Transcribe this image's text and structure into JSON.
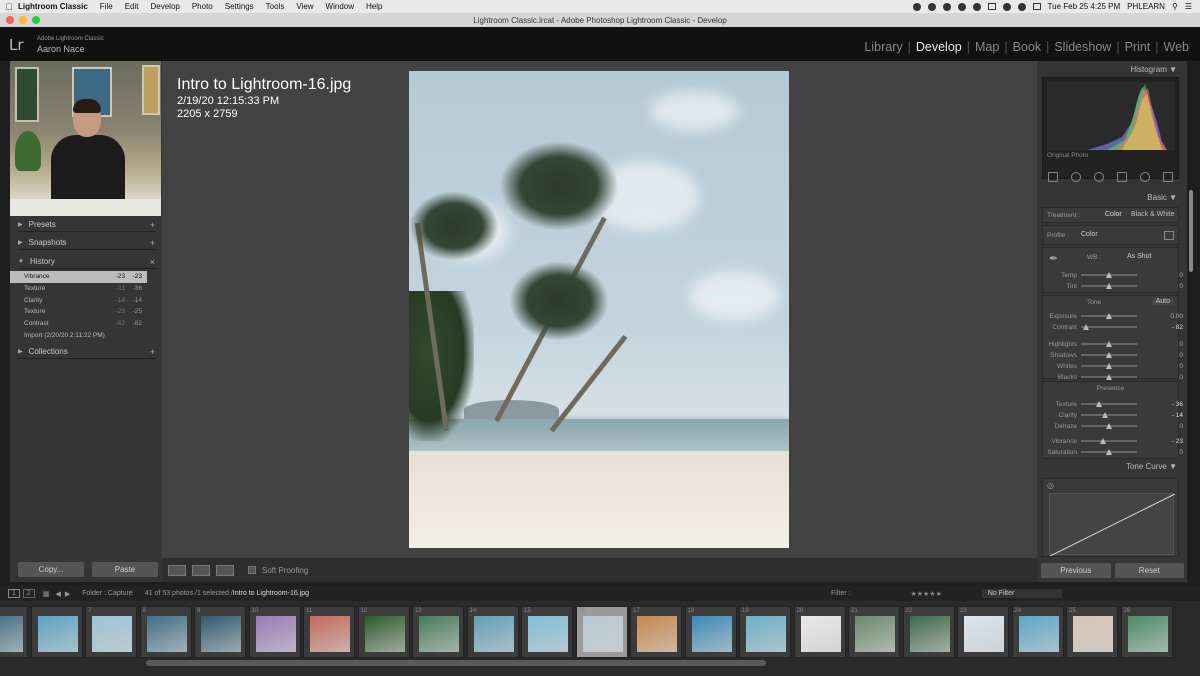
{
  "menubar": {
    "app": "Lightroom Classic",
    "items": [
      "File",
      "Edit",
      "Develop",
      "Photo",
      "Settings",
      "Tools",
      "View",
      "Window",
      "Help"
    ],
    "clock": "Tue Feb 25  4:25 PM",
    "user": "PHLEARN"
  },
  "window": {
    "title": "Lightroom Classic.lrcat - Adobe Photoshop Lightroom Classic - Develop"
  },
  "identity": {
    "logo": "Lr",
    "app": "Adobe Lightroom Classic",
    "user": "Aaron Nace"
  },
  "modules": [
    "Library",
    "Develop",
    "Map",
    "Book",
    "Slideshow",
    "Print",
    "Web"
  ],
  "left": {
    "presets": "Presets",
    "snapshots": "Snapshots",
    "history": "History",
    "collections": "Collections",
    "history_items": [
      {
        "name": "Vibrance",
        "v1": "-23",
        "v2": "-23"
      },
      {
        "name": "Texture",
        "v1": "-11",
        "v2": "-36"
      },
      {
        "name": "Clarity",
        "v1": "-14",
        "v2": "-14"
      },
      {
        "name": "Texture",
        "v1": "-25",
        "v2": "-25"
      },
      {
        "name": "Contrast",
        "v1": "-82",
        "v2": "-82"
      },
      {
        "name": "Import (2/20/20 2:11:22 PM)",
        "v1": "",
        "v2": ""
      }
    ],
    "copy": "Copy...",
    "paste": "Paste"
  },
  "photo": {
    "filename": "Intro to Lightroom-16.jpg",
    "date": "2/19/20 12:15:33 PM",
    "dims": "2205 x 2759"
  },
  "toolbar": {
    "soft_proofing": "Soft Proofing"
  },
  "right": {
    "histogram": "Histogram",
    "original_photo": "Original Photo",
    "basic": "Basic",
    "treatment": "Treatment :",
    "color": "Color",
    "bw": "Black & White",
    "profile": "Profile :",
    "profile_value": "Color",
    "wb": "WB :",
    "wb_value": "As Shot",
    "tone": "Tone",
    "auto": "Auto",
    "presence": "Presence",
    "sliders": [
      {
        "label": "Temp",
        "value": "0",
        "pos": 0.5
      },
      {
        "label": "Tint",
        "value": "0",
        "pos": 0.5
      },
      {
        "label": "Exposure",
        "value": "0.00",
        "pos": 0.5
      },
      {
        "label": "Contrast",
        "value": "- 82",
        "pos": 0.09
      },
      {
        "label": "Highlights",
        "value": "0",
        "pos": 0.5
      },
      {
        "label": "Shadows",
        "value": "0",
        "pos": 0.5
      },
      {
        "label": "Whites",
        "value": "0",
        "pos": 0.5
      },
      {
        "label": "Blacks",
        "value": "0",
        "pos": 0.5
      },
      {
        "label": "Texture",
        "value": "- 36",
        "pos": 0.32
      },
      {
        "label": "Clarity",
        "value": "- 14",
        "pos": 0.43
      },
      {
        "label": "Dehaze",
        "value": "0",
        "pos": 0.5
      },
      {
        "label": "Vibrance",
        "value": "- 23",
        "pos": 0.385
      },
      {
        "label": "Saturation",
        "value": "0",
        "pos": 0.5
      }
    ],
    "tone_curve": "Tone Curve",
    "previous": "Previous",
    "reset": "Reset"
  },
  "filmstrip": {
    "folder": "Folder : Capture",
    "count": "41 of 53 photos /1 selected /",
    "current": "Intro to Lightroom-16.jpg",
    "filter_label": "Filter :",
    "filter_value": "No Filter",
    "thumbs": [
      {
        "num": "",
        "color": "#3b6a80"
      },
      {
        "num": "",
        "color": "#5aa3c4"
      },
      {
        "num": "7",
        "color": "#9bc4d8"
      },
      {
        "num": "8",
        "color": "#3e6f86"
      },
      {
        "num": "9",
        "color": "#2f5a70"
      },
      {
        "num": "10",
        "color": "#9a7ab8"
      },
      {
        "num": "11",
        "color": "#c46a5a"
      },
      {
        "num": "12",
        "color": "#2f5a2c"
      },
      {
        "num": "13",
        "color": "#4a7a5a"
      },
      {
        "num": "14",
        "color": "#5fa0b8"
      },
      {
        "num": "15",
        "color": "#7fc0d8"
      },
      {
        "num": "16",
        "color": "#b8cad4"
      },
      {
        "num": "17",
        "color": "#c8884a"
      },
      {
        "num": "18",
        "color": "#3a8ab8"
      },
      {
        "num": "19",
        "color": "#6ab0c8"
      },
      {
        "num": "20",
        "color": "#e8e8e8"
      },
      {
        "num": "21",
        "color": "#6a8a6a"
      },
      {
        "num": "22",
        "color": "#3f6a4a"
      },
      {
        "num": "23",
        "color": "#d8e4ec"
      },
      {
        "num": "24",
        "color": "#5aa8c8"
      },
      {
        "num": "25",
        "color": "#d8c4b0"
      },
      {
        "num": "26",
        "color": "#4a8a6a"
      }
    ]
  }
}
